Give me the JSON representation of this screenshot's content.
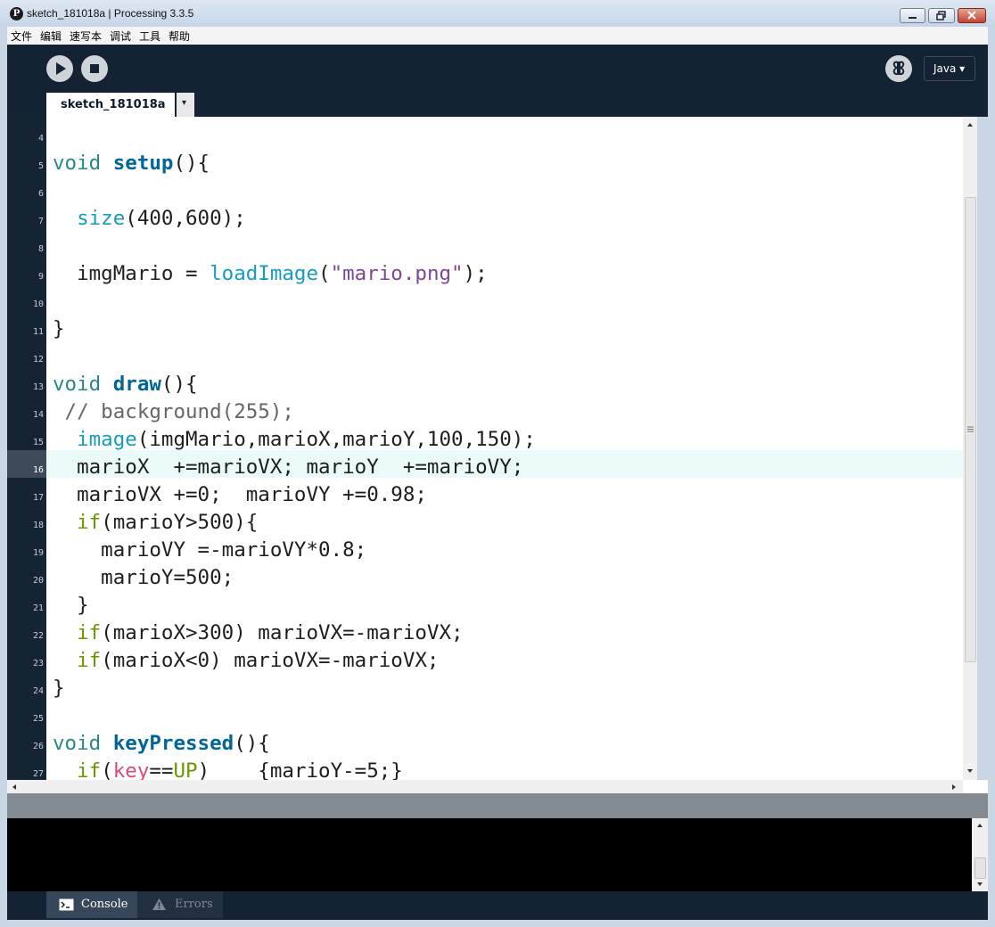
{
  "window": {
    "title": "sketch_181018a | Processing 3.3.5",
    "app_icon_letter": "P"
  },
  "menu": [
    "文件",
    "编辑",
    "速写本",
    "调试",
    "工具",
    "帮助"
  ],
  "toolbar": {
    "run_icon": "play-icon",
    "stop_icon": "stop-icon",
    "debugger_icon": "debugger-butterfly-icon",
    "mode_label": "Java ▾"
  },
  "tabs": {
    "active": "sketch_181018a",
    "menu_arrow": "▾"
  },
  "editor": {
    "current_line": 16,
    "lines": [
      {
        "n": "4",
        "tokens": []
      },
      {
        "n": "5",
        "tokens": [
          {
            "t": "void",
            "c": "kw"
          },
          {
            "t": " "
          },
          {
            "t": "setup",
            "c": "fn"
          },
          {
            "t": "(){"
          }
        ]
      },
      {
        "n": "6",
        "tokens": []
      },
      {
        "n": "7",
        "tokens": [
          {
            "t": "  "
          },
          {
            "t": "size",
            "c": "bi"
          },
          {
            "t": "(400,600);"
          }
        ]
      },
      {
        "n": "8",
        "tokens": []
      },
      {
        "n": "9",
        "tokens": [
          {
            "t": "  imgMario = "
          },
          {
            "t": "loadImage",
            "c": "bi"
          },
          {
            "t": "("
          },
          {
            "t": "\"mario.png\"",
            "c": "str"
          },
          {
            "t": ");"
          }
        ]
      },
      {
        "n": "10",
        "tokens": []
      },
      {
        "n": "11",
        "tokens": [
          {
            "t": "}"
          }
        ]
      },
      {
        "n": "12",
        "tokens": []
      },
      {
        "n": "13",
        "tokens": [
          {
            "t": "void",
            "c": "kw"
          },
          {
            "t": " "
          },
          {
            "t": "draw",
            "c": "fn"
          },
          {
            "t": "(){"
          }
        ]
      },
      {
        "n": "14",
        "tokens": [
          {
            "t": " // background(255);",
            "c": "cm"
          }
        ]
      },
      {
        "n": "15",
        "tokens": [
          {
            "t": "  "
          },
          {
            "t": "image",
            "c": "bi"
          },
          {
            "t": "(imgMario,marioX,marioY,100,150);"
          }
        ]
      },
      {
        "n": "16",
        "tokens": [
          {
            "t": "  marioX  +=marioVX; marioY  +=marioVY;"
          }
        ]
      },
      {
        "n": "17",
        "tokens": [
          {
            "t": "  marioVX +=0;  marioVY +=0.98;"
          }
        ]
      },
      {
        "n": "18",
        "tokens": [
          {
            "t": "  "
          },
          {
            "t": "if",
            "c": "ctl"
          },
          {
            "t": "(marioY>500){"
          }
        ]
      },
      {
        "n": "19",
        "tokens": [
          {
            "t": "    marioVY =-marioVY*0.8;"
          }
        ]
      },
      {
        "n": "20",
        "tokens": [
          {
            "t": "    marioY=500;"
          }
        ]
      },
      {
        "n": "21",
        "tokens": [
          {
            "t": "  }"
          }
        ]
      },
      {
        "n": "22",
        "tokens": [
          {
            "t": "  "
          },
          {
            "t": "if",
            "c": "ctl"
          },
          {
            "t": "(marioX>300) marioVX=-marioVX;"
          }
        ]
      },
      {
        "n": "23",
        "tokens": [
          {
            "t": "  "
          },
          {
            "t": "if",
            "c": "ctl"
          },
          {
            "t": "(marioX<0) marioVX=-marioVX;"
          }
        ]
      },
      {
        "n": "24",
        "tokens": [
          {
            "t": "}"
          }
        ]
      },
      {
        "n": "25",
        "tokens": []
      },
      {
        "n": "26",
        "tokens": [
          {
            "t": "void",
            "c": "kw"
          },
          {
            "t": " "
          },
          {
            "t": "keyPressed",
            "c": "fn"
          },
          {
            "t": "(){"
          }
        ]
      },
      {
        "n": "27",
        "tokens": [
          {
            "t": "  "
          },
          {
            "t": "if",
            "c": "ctl"
          },
          {
            "t": "("
          },
          {
            "t": "key",
            "c": "var"
          },
          {
            "t": "=="
          },
          {
            "t": "UP",
            "c": "ctl"
          },
          {
            "t": ")    {marioY-=5;}"
          }
        ]
      }
    ]
  },
  "footer": {
    "console_label": "Console",
    "console_icon": "terminal-icon",
    "errors_label": "Errors",
    "errors_icon": "warning-icon"
  }
}
